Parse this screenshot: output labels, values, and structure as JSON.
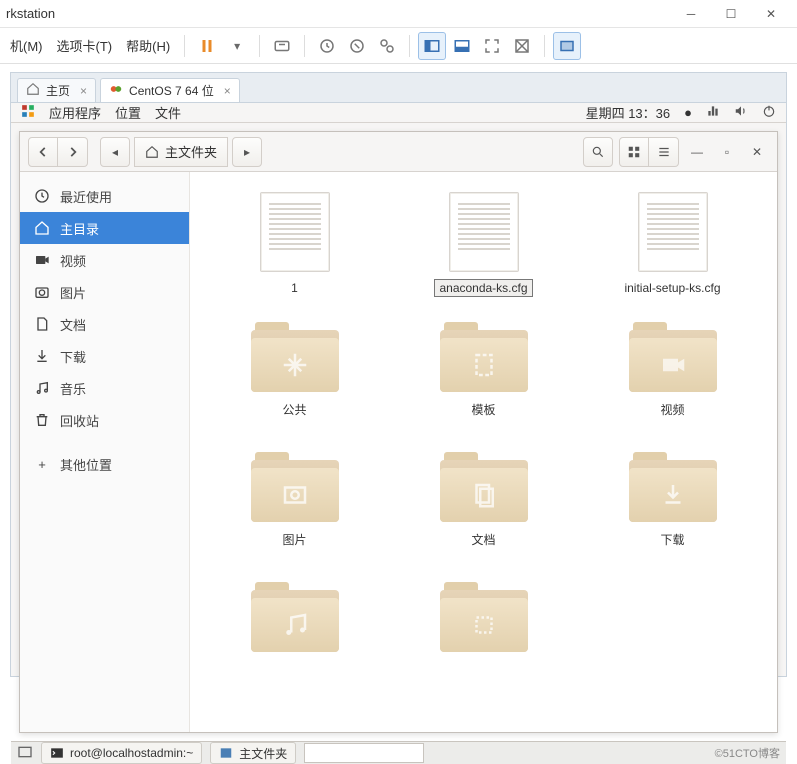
{
  "vm": {
    "title": "rkstation",
    "menu": [
      "机(M)",
      "选项卡(T)",
      "帮助(H)"
    ],
    "tabs": {
      "home": "主页",
      "guest": "CentOS 7 64 位"
    }
  },
  "gnome": {
    "apps_label": "应用程序",
    "places_label": "位置",
    "files_label": "文件",
    "clock": "星期四 13：36"
  },
  "fm": {
    "location": "主文件夹",
    "sidebar": [
      {
        "id": "recent",
        "label": "最近使用"
      },
      {
        "id": "home",
        "label": "主目录"
      },
      {
        "id": "videos",
        "label": "视频"
      },
      {
        "id": "pictures",
        "label": "图片"
      },
      {
        "id": "documents",
        "label": "文档"
      },
      {
        "id": "downloads",
        "label": "下载"
      },
      {
        "id": "music",
        "label": "音乐"
      },
      {
        "id": "trash",
        "label": "回收站"
      },
      {
        "id": "other",
        "label": "其他位置"
      }
    ],
    "items": [
      {
        "type": "doc",
        "label": "1"
      },
      {
        "type": "doc",
        "label": "anaconda-ks.cfg",
        "selected": true
      },
      {
        "type": "doc",
        "label": "initial-setup-ks.cfg"
      },
      {
        "type": "folder",
        "icon": "share",
        "label": "公共"
      },
      {
        "type": "folder",
        "icon": "template",
        "label": "模板"
      },
      {
        "type": "folder",
        "icon": "video",
        "label": "视频"
      },
      {
        "type": "folder",
        "icon": "picture",
        "label": "图片"
      },
      {
        "type": "folder",
        "icon": "document",
        "label": "文档"
      },
      {
        "type": "folder",
        "icon": "download",
        "label": "下载"
      },
      {
        "type": "folder",
        "icon": "music",
        "label": ""
      },
      {
        "type": "folder",
        "icon": "generic",
        "label": ""
      }
    ]
  },
  "taskbar": {
    "terminal": "root@localhostadmin:~",
    "fm_label": "主文件夹",
    "watermark": "©51CTO博客"
  }
}
